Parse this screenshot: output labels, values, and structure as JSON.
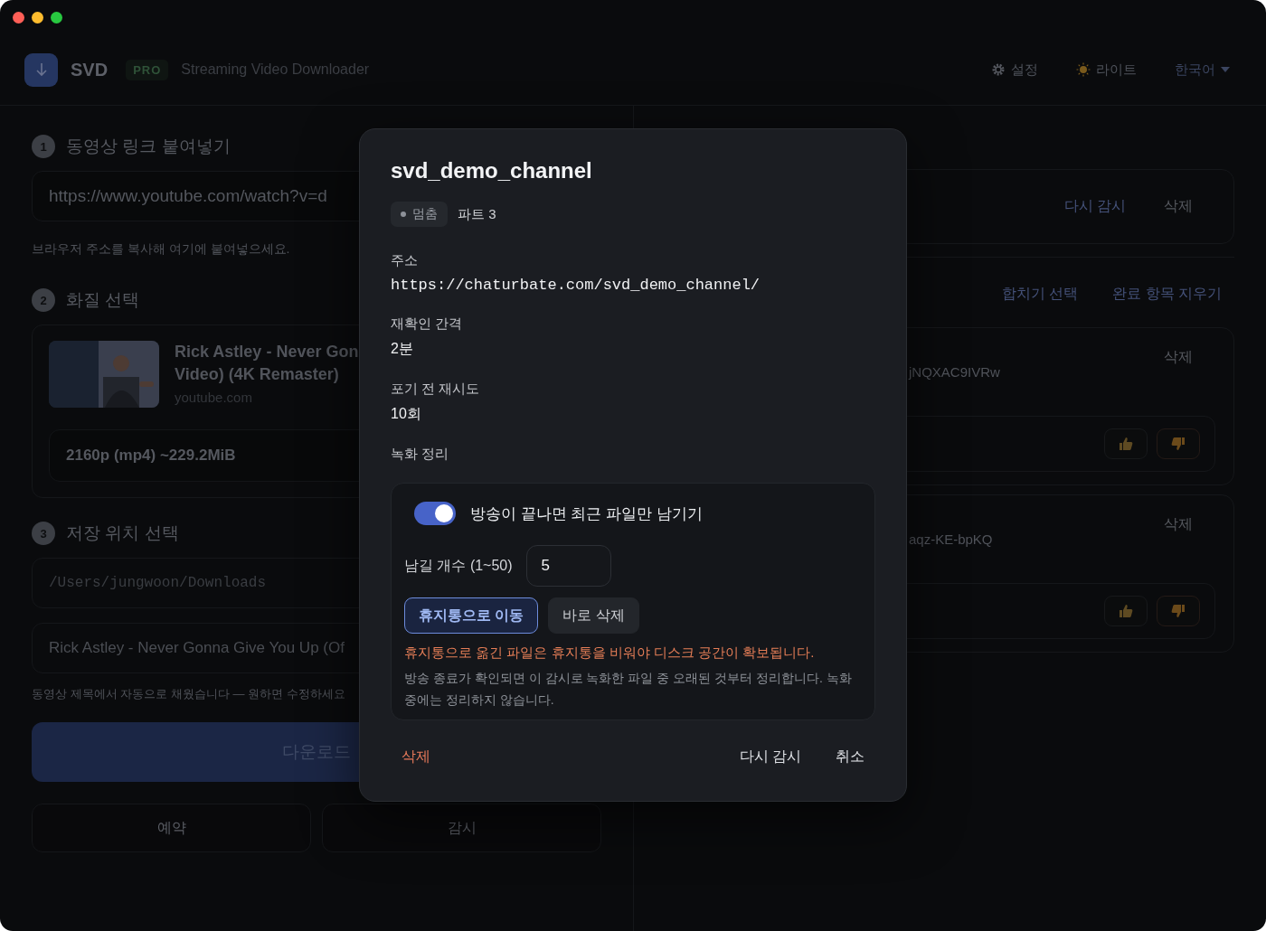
{
  "header": {
    "app_name": "SVD",
    "badge": "PRO",
    "subtitle": "Streaming Video Downloader",
    "actions": [
      {
        "kind": "settings",
        "label": "설정"
      },
      {
        "kind": "theme",
        "label": "라이트"
      },
      {
        "kind": "language",
        "label": "한국어"
      }
    ]
  },
  "download_panel": {
    "link_step": {
      "number": "1",
      "title": "동영상 링크 붙여넣기",
      "url_value": "https://www.youtube.com/watch?v=d",
      "hint": "브라우저 주소를 복사해 여기에 붙여넣으세요."
    },
    "quality_step": {
      "number": "2",
      "title": "화질 선택",
      "video_title": [
        "Rick Astley - Never Gon",
        "Video) (4K Remaster)"
      ],
      "source": "youtube.com",
      "format": "2160p (mp4) ~229.2MiB"
    },
    "location_step": {
      "number": "3",
      "title": "저장 위치 선택",
      "folder": "/Users/jungwoon/Downloads",
      "filename": "Rick Astley - Never Gonna Give You Up (Of",
      "hint": "동영상 제목에서 자동으로 채웠습니다 — 원하면 수정하세요"
    },
    "download_button": "다운로드",
    "secondary_buttons": [
      "예약",
      "감시"
    ]
  },
  "watch_panel": {
    "monitor_actions": [
      "다시 감시",
      "삭제"
    ],
    "queue_actions": [
      "합치기 선택",
      "완료 항목 지우기"
    ],
    "items": [
      {
        "url_tail": "jNQXAC9IVRw",
        "delete": "삭제"
      },
      {
        "url_tail": "aqz-KE-bpKQ",
        "delete": "삭제"
      }
    ]
  },
  "dialog": {
    "title": "svd_demo_channel",
    "status": "멈춤",
    "part": "파트 3",
    "fields": [
      {
        "label": "주소",
        "value": "https://chaturbate.com/svd_demo_channel/",
        "kind": "mono"
      },
      {
        "label": "재확인 간격",
        "value": "2분",
        "kind": "text"
      },
      {
        "label": "포기 전 재시도",
        "value": "10회",
        "kind": "text"
      }
    ],
    "cleanup": {
      "label": "녹화 정리",
      "toggle": {
        "label": "방송이 끝나면 최근 파일만 남기기",
        "on": true
      },
      "keep_count": {
        "label": "남길 개수 (1~50)",
        "value": "5"
      },
      "modes": [
        {
          "label": "휴지통으로 이동",
          "selected": true
        },
        {
          "label": "바로 삭제",
          "selected": false
        }
      ],
      "warning": "휴지통으로 옮긴 파일은 휴지통을 비워야 디스크 공간이 확보됩니다.",
      "note": "방송 종료가 확인되면 이 감시로 녹화한 파일 중 오래된 것부터 정리합니다. 녹화 중에는 정리하지 않습니다."
    },
    "footer": {
      "delete": "삭제",
      "rewatch": "다시 감시",
      "cancel": "취소"
    }
  }
}
